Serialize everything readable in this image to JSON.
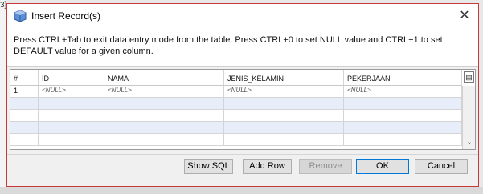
{
  "background": {
    "fragment": "3]"
  },
  "dialog": {
    "title": "Insert Record(s)",
    "close_glyph": "✕",
    "info": "Press CTRL+Tab to exit data entry mode from the table. Press CTRL+0 to set NULL value and CTRL+1 to set DEFAULT value for a given column."
  },
  "table": {
    "columns": [
      "#",
      "ID",
      "NAMA",
      "JENIS_KELAMIN",
      "PEKERJAAN"
    ],
    "rows": [
      [
        "1",
        "<NULL>",
        "<NULL>",
        "<NULL>",
        "<NULL>"
      ]
    ],
    "scroll_down_glyph": "⌄",
    "column_menu_glyph": "▤"
  },
  "buttons": {
    "show_sql": "Show SQL",
    "add_row": "Add Row",
    "remove": "Remove",
    "ok": "OK",
    "cancel": "Cancel"
  },
  "colors": {
    "dialog_border": "#c83a3a",
    "alt_row": "#e7eef9",
    "focus_border": "#0078d7"
  }
}
